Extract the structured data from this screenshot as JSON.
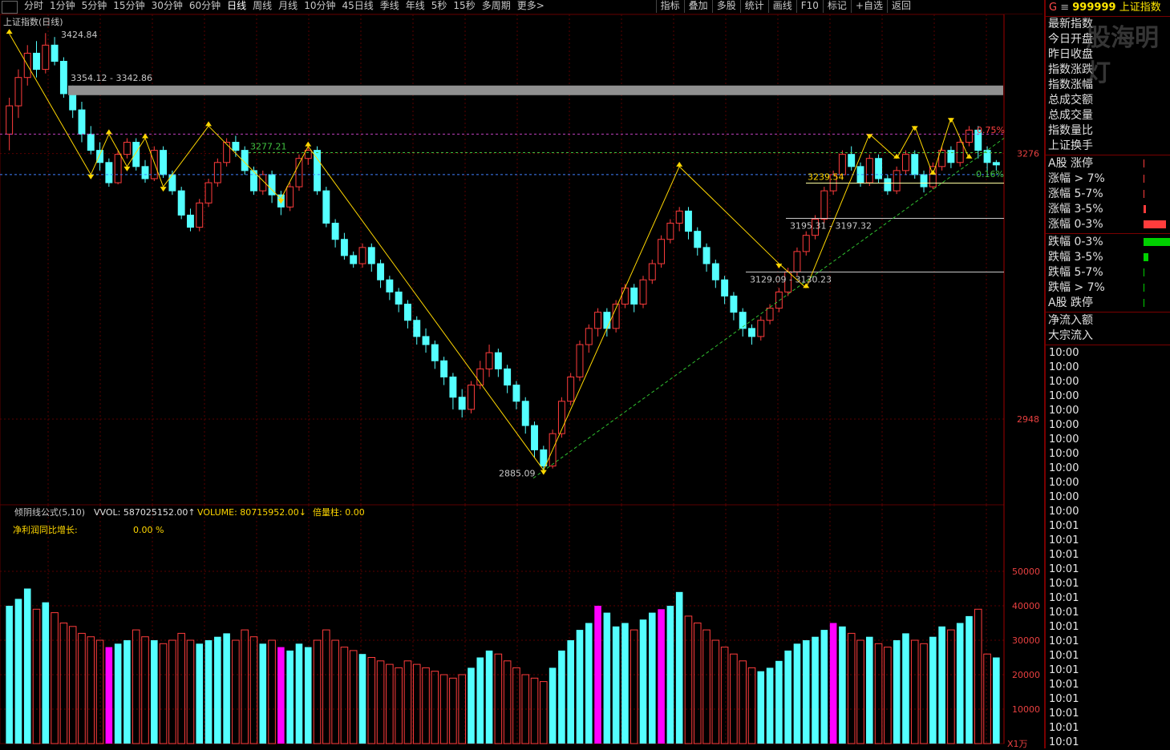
{
  "toolbar": {
    "periods": [
      "分时",
      "1分钟",
      "5分钟",
      "15分钟",
      "30分钟",
      "60分钟",
      "日线",
      "周线",
      "月线",
      "10分钟",
      "45日线",
      "季线",
      "年线",
      "5秒",
      "15秒",
      "多周期",
      "更多>"
    ],
    "active_period": "日线",
    "tools": [
      "指标",
      "叠加",
      "多股",
      "统计",
      "画线",
      "F10",
      "标记",
      "+自选",
      "返回"
    ]
  },
  "main_chart": {
    "title": "上证指数(日线)",
    "high_label": "3424.84",
    "low_label": "2885.09",
    "zone_label": "3354.12 - 3342.86",
    "green_line_label": "3277.21",
    "level_3239": "3239.54",
    "level_3195": "3195.31 - 3197.32",
    "level_3129": "3129.09 - 3130.23",
    "pct_label_1": "0.75%",
    "pct_label_2": "-0.16%",
    "y_labels": [
      "3276",
      "2948"
    ]
  },
  "sub_chart": {
    "indicator": "倾阴线公式(5,10)",
    "vvol_label": "VVOL: 587025152.00↑",
    "volume_label": "VOLUME: 80715952.00↓",
    "beiliang_label": "倍量柱: 0.00",
    "profit_label": "净利润同比增长:",
    "profit_value": "0.00 %",
    "y_labels": [
      "50000",
      "40000",
      "30000",
      "20000",
      "10000"
    ],
    "unit": "X1万"
  },
  "chart_data": {
    "type": "candlestick",
    "ylim": [
      2850,
      3440
    ],
    "vol_ylim": [
      0,
      60000
    ],
    "candles": [
      [
        3300,
        3335,
        3345,
        3280
      ],
      [
        3335,
        3370,
        3380,
        3320
      ],
      [
        3370,
        3400,
        3410,
        3360
      ],
      [
        3400,
        3380,
        3415,
        3370
      ],
      [
        3380,
        3410,
        3424.84,
        3375
      ],
      [
        3410,
        3390,
        3420,
        3385
      ],
      [
        3390,
        3350,
        3395,
        3345
      ],
      [
        3350,
        3330,
        3360,
        3320
      ],
      [
        3330,
        3300,
        3340,
        3290
      ],
      [
        3300,
        3280,
        3310,
        3275
      ],
      [
        3280,
        3265,
        3290,
        3255
      ],
      [
        3265,
        3240,
        3270,
        3235
      ],
      [
        3240,
        3275,
        3280,
        3238
      ],
      [
        3275,
        3290,
        3295,
        3270
      ],
      [
        3290,
        3260,
        3295,
        3255
      ],
      [
        3260,
        3245,
        3268,
        3240
      ],
      [
        3245,
        3280,
        3285,
        3242
      ],
      [
        3280,
        3250,
        3285,
        3246
      ],
      [
        3250,
        3230,
        3255,
        3225
      ],
      [
        3230,
        3200,
        3235,
        3195
      ],
      [
        3200,
        3185,
        3208,
        3180
      ],
      [
        3185,
        3215,
        3220,
        3180
      ],
      [
        3215,
        3240,
        3245,
        3210
      ],
      [
        3240,
        3265,
        3270,
        3235
      ],
      [
        3265,
        3290,
        3295,
        3260
      ],
      [
        3290,
        3280,
        3298,
        3272
      ],
      [
        3280,
        3255,
        3285,
        3250
      ],
      [
        3255,
        3230,
        3260,
        3225
      ],
      [
        3230,
        3250,
        3255,
        3225
      ],
      [
        3250,
        3225,
        3255,
        3215
      ],
      [
        3225,
        3210,
        3230,
        3200
      ],
      [
        3210,
        3235,
        3240,
        3205
      ],
      [
        3235,
        3270,
        3275,
        3230
      ],
      [
        3270,
        3280,
        3285,
        3262
      ],
      [
        3280,
        3230,
        3285,
        3225
      ],
      [
        3230,
        3190,
        3235,
        3185
      ],
      [
        3190,
        3170,
        3195,
        3160
      ],
      [
        3170,
        3150,
        3178,
        3145
      ],
      [
        3150,
        3140,
        3155,
        3135
      ],
      [
        3140,
        3160,
        3165,
        3135
      ],
      [
        3160,
        3140,
        3165,
        3130
      ],
      [
        3140,
        3120,
        3145,
        3110
      ],
      [
        3120,
        3105,
        3125,
        3095
      ],
      [
        3105,
        3090,
        3110,
        3080
      ],
      [
        3090,
        3070,
        3095,
        3060
      ],
      [
        3070,
        3050,
        3075,
        3040
      ],
      [
        3050,
        3040,
        3060,
        3030
      ],
      [
        3040,
        3020,
        3045,
        3010
      ],
      [
        3020,
        3000,
        3025,
        2990
      ],
      [
        3000,
        2975,
        3005,
        2960
      ],
      [
        2975,
        2960,
        2985,
        2950
      ],
      [
        2960,
        2990,
        2995,
        2955
      ],
      [
        2990,
        3010,
        3020,
        2985
      ],
      [
        3010,
        3030,
        3040,
        3000
      ],
      [
        3030,
        3010,
        3035,
        3000
      ],
      [
        3010,
        2990,
        3015,
        2980
      ],
      [
        2990,
        2970,
        2995,
        2960
      ],
      [
        2970,
        2940,
        2975,
        2930
      ],
      [
        2940,
        2910,
        2945,
        2900
      ],
      [
        2910,
        2890,
        2915,
        2885.09
      ],
      [
        2890,
        2930,
        2935,
        2887
      ],
      [
        2930,
        2970,
        2975,
        2925
      ],
      [
        2970,
        3000,
        3005,
        2965
      ],
      [
        3000,
        3040,
        3045,
        2995
      ],
      [
        3040,
        3060,
        3065,
        3030
      ],
      [
        3060,
        3080,
        3085,
        3050
      ],
      [
        3080,
        3060,
        3085,
        3050
      ],
      [
        3060,
        3090,
        3095,
        3055
      ],
      [
        3090,
        3110,
        3115,
        3085
      ],
      [
        3110,
        3090,
        3115,
        3080
      ],
      [
        3090,
        3120,
        3125,
        3085
      ],
      [
        3120,
        3140,
        3145,
        3115
      ],
      [
        3140,
        3170,
        3175,
        3135
      ],
      [
        3170,
        3190,
        3195,
        3165
      ],
      [
        3190,
        3205,
        3210,
        3180
      ],
      [
        3205,
        3180,
        3210,
        3170
      ],
      [
        3180,
        3160,
        3185,
        3150
      ],
      [
        3160,
        3140,
        3165,
        3130
      ],
      [
        3140,
        3120,
        3145,
        3110
      ],
      [
        3120,
        3100,
        3125,
        3090
      ],
      [
        3100,
        3080,
        3105,
        3070
      ],
      [
        3080,
        3060,
        3085,
        3050
      ],
      [
        3060,
        3050,
        3065,
        3040
      ],
      [
        3050,
        3070,
        3075,
        3045
      ],
      [
        3070,
        3085,
        3090,
        3065
      ],
      [
        3085,
        3105,
        3110,
        3080
      ],
      [
        3105,
        3130,
        3135,
        3100
      ],
      [
        3130,
        3155,
        3160,
        3125
      ],
      [
        3155,
        3175,
        3180,
        3150
      ],
      [
        3175,
        3195,
        3200,
        3170
      ],
      [
        3195,
        3230,
        3235,
        3190
      ],
      [
        3230,
        3250,
        3255,
        3225
      ],
      [
        3250,
        3275,
        3280,
        3245
      ],
      [
        3275,
        3260,
        3285,
        3255
      ],
      [
        3260,
        3240,
        3265,
        3235
      ],
      [
        3240,
        3270,
        3275,
        3236
      ],
      [
        3270,
        3245,
        3275,
        3240
      ],
      [
        3245,
        3230,
        3250,
        3225
      ],
      [
        3230,
        3255,
        3260,
        3226
      ],
      [
        3255,
        3275,
        3280,
        3250
      ],
      [
        3275,
        3250,
        3280,
        3245
      ],
      [
        3250,
        3235,
        3255,
        3228
      ],
      [
        3235,
        3260,
        3265,
        3232
      ],
      [
        3260,
        3280,
        3285,
        3255
      ],
      [
        3280,
        3265,
        3285,
        3258
      ],
      [
        3265,
        3290,
        3295,
        3260
      ],
      [
        3290,
        3305,
        3310,
        3285
      ],
      [
        3305,
        3280,
        3310,
        3270
      ],
      [
        3280,
        3265,
        3285,
        3255
      ],
      [
        3265,
        3262,
        3268,
        3255
      ]
    ],
    "volumes": [
      [
        40000,
        "up"
      ],
      [
        42000,
        "up"
      ],
      [
        45000,
        "up"
      ],
      [
        39000,
        "down"
      ],
      [
        41000,
        "up"
      ],
      [
        38000,
        "down"
      ],
      [
        35000,
        "down"
      ],
      [
        34000,
        "down"
      ],
      [
        32000,
        "down"
      ],
      [
        31000,
        "down"
      ],
      [
        30000,
        "down"
      ],
      [
        28000,
        "pink"
      ],
      [
        29000,
        "up"
      ],
      [
        30000,
        "up"
      ],
      [
        33000,
        "down"
      ],
      [
        31000,
        "down"
      ],
      [
        30000,
        "up"
      ],
      [
        29000,
        "down"
      ],
      [
        30000,
        "down"
      ],
      [
        32000,
        "down"
      ],
      [
        30000,
        "down"
      ],
      [
        29000,
        "up"
      ],
      [
        30000,
        "up"
      ],
      [
        31000,
        "up"
      ],
      [
        32000,
        "up"
      ],
      [
        30000,
        "down"
      ],
      [
        33000,
        "down"
      ],
      [
        31000,
        "down"
      ],
      [
        29000,
        "up"
      ],
      [
        30000,
        "down"
      ],
      [
        28000,
        "pink"
      ],
      [
        27000,
        "up"
      ],
      [
        29000,
        "up"
      ],
      [
        28000,
        "up"
      ],
      [
        30000,
        "down"
      ],
      [
        33000,
        "down"
      ],
      [
        30000,
        "down"
      ],
      [
        28000,
        "down"
      ],
      [
        27000,
        "down"
      ],
      [
        26000,
        "up"
      ],
      [
        25000,
        "down"
      ],
      [
        24000,
        "down"
      ],
      [
        23000,
        "down"
      ],
      [
        22000,
        "down"
      ],
      [
        24000,
        "down"
      ],
      [
        23000,
        "down"
      ],
      [
        22000,
        "down"
      ],
      [
        21000,
        "down"
      ],
      [
        20000,
        "down"
      ],
      [
        19000,
        "down"
      ],
      [
        20000,
        "down"
      ],
      [
        22000,
        "up"
      ],
      [
        25000,
        "up"
      ],
      [
        27000,
        "up"
      ],
      [
        26000,
        "down"
      ],
      [
        24000,
        "down"
      ],
      [
        22000,
        "down"
      ],
      [
        20000,
        "down"
      ],
      [
        19000,
        "down"
      ],
      [
        18000,
        "down"
      ],
      [
        22000,
        "up"
      ],
      [
        27000,
        "up"
      ],
      [
        30000,
        "up"
      ],
      [
        33000,
        "up"
      ],
      [
        35000,
        "up"
      ],
      [
        40000,
        "pink"
      ],
      [
        38000,
        "up"
      ],
      [
        34000,
        "up"
      ],
      [
        35000,
        "up"
      ],
      [
        33000,
        "down"
      ],
      [
        36000,
        "up"
      ],
      [
        38000,
        "up"
      ],
      [
        39000,
        "pink"
      ],
      [
        40000,
        "up"
      ],
      [
        44000,
        "up"
      ],
      [
        37000,
        "down"
      ],
      [
        35000,
        "down"
      ],
      [
        33000,
        "down"
      ],
      [
        30000,
        "down"
      ],
      [
        28000,
        "down"
      ],
      [
        26000,
        "down"
      ],
      [
        24000,
        "down"
      ],
      [
        22000,
        "down"
      ],
      [
        21000,
        "up"
      ],
      [
        22000,
        "up"
      ],
      [
        24000,
        "up"
      ],
      [
        27000,
        "up"
      ],
      [
        29000,
        "up"
      ],
      [
        30000,
        "up"
      ],
      [
        31000,
        "up"
      ],
      [
        33000,
        "up"
      ],
      [
        35000,
        "pink"
      ],
      [
        34000,
        "up"
      ],
      [
        32000,
        "down"
      ],
      [
        30000,
        "down"
      ],
      [
        31000,
        "up"
      ],
      [
        29000,
        "down"
      ],
      [
        28000,
        "down"
      ],
      [
        30000,
        "up"
      ],
      [
        32000,
        "up"
      ],
      [
        30000,
        "down"
      ],
      [
        29000,
        "down"
      ],
      [
        31000,
        "up"
      ],
      [
        34000,
        "up"
      ],
      [
        33000,
        "down"
      ],
      [
        35000,
        "up"
      ],
      [
        37000,
        "up"
      ],
      [
        39000,
        "down"
      ],
      [
        26000,
        "down"
      ],
      [
        25000,
        "up"
      ]
    ]
  },
  "sidebar": {
    "code": "999999",
    "name": "上证指数",
    "prefix": "G",
    "menu": "≡",
    "watermark": "股海明灯",
    "fields": [
      "最新指数",
      "今日开盘",
      "昨日收盘",
      "指数涨跌",
      "指数涨幅",
      "总成交额",
      "总成交量",
      "指数量比",
      "上证换手"
    ],
    "up_rows": [
      "A股 涨停",
      "涨幅 > 7%",
      "涨幅 5-7%",
      "涨幅 3-5%",
      "涨幅 0-3%"
    ],
    "down_rows": [
      "跌幅 0-3%",
      "跌幅 3-5%",
      "跌幅 5-7%",
      "跌幅 > 7%",
      "A股 跌停"
    ],
    "flow_rows": [
      "净流入额",
      "大宗流入"
    ],
    "ticks": [
      "10:00",
      "10:00",
      "10:00",
      "10:00",
      "10:00",
      "10:00",
      "10:00",
      "10:00",
      "10:00",
      "10:00",
      "10:00",
      "10:00",
      "10:01",
      "10:01",
      "10:01",
      "10:01",
      "10:01",
      "10:01",
      "10:01",
      "10:01",
      "10:01",
      "10:01",
      "10:01",
      "10:01",
      "10:01",
      "10:01",
      "10:01",
      "10:01"
    ]
  },
  "colors": {
    "up": "#ff3c3c",
    "down": "#54ffff",
    "pink": "#ff00ff",
    "zigzag": "#ffd700",
    "grid": "#5a0000"
  }
}
